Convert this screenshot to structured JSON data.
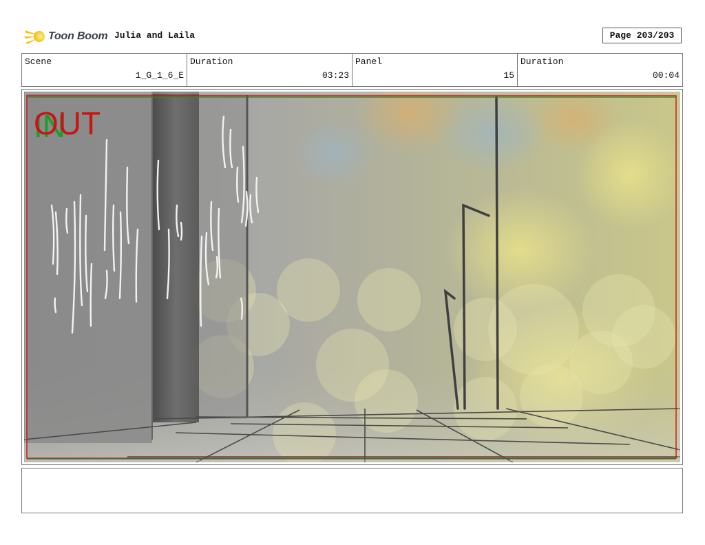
{
  "header": {
    "logo_text": "Toon Boom",
    "project_title": "Julia and Laila",
    "page_label": "Page 203/203"
  },
  "info": {
    "scene_label": "Scene",
    "scene_value": "1_G_1_6_E",
    "scene_duration_label": "Duration",
    "scene_duration_value": "03:23",
    "panel_label": "Panel",
    "panel_value": "15",
    "panel_duration_label": "Duration",
    "panel_duration_value": "00:04"
  },
  "panel": {
    "in_marker": "IN",
    "out_marker": "OUT",
    "in_color": "#1a9e2a",
    "out_color": "#c81414"
  },
  "notes": {
    "text": ""
  }
}
